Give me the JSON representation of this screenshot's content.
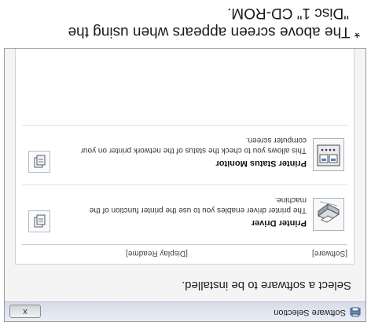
{
  "window": {
    "title": "Software Selection",
    "close_label": "x"
  },
  "heading": "Select a software to be installed.",
  "columns": {
    "software": "[Software]",
    "display_readme": "[Display Readme]"
  },
  "items": [
    {
      "title": "Printer Driver",
      "description": "The printer driver enables you to use the printer function of the machine.",
      "icon": "printer-driver-icon"
    },
    {
      "title": "Printer Status Monitor",
      "description": "This allows you to check the status of the network printer on your computer screen.",
      "icon": "status-monitor-icon"
    }
  ],
  "caption": {
    "line1": "* The above screen appears when using the",
    "line2": "\"Disc 1\" CD-ROM."
  },
  "rotation": "180deg"
}
